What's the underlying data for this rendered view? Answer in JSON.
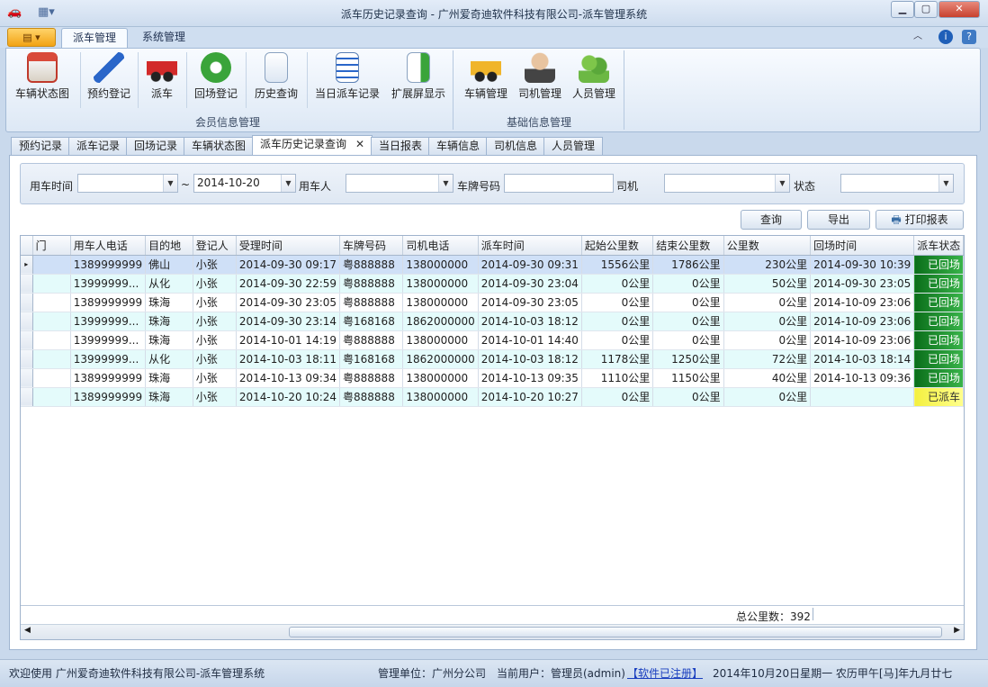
{
  "window": {
    "title": "派车历史记录查询 - 广州爱奇迪软件科技有限公司-派车管理系统"
  },
  "ribbon_tabs": [
    "派车管理",
    "系统管理"
  ],
  "ribbon_buttons": [
    {
      "label": "车辆状态图",
      "icon": "house-icon"
    },
    {
      "label": "预约登记",
      "icon": "pencil-icon"
    },
    {
      "label": "派车",
      "icon": "red-car-icon"
    },
    {
      "label": "回场登记",
      "icon": "green-refresh-icon"
    },
    {
      "label": "历史查询",
      "icon": "document-search-icon"
    },
    {
      "label": "当日派车记录",
      "icon": "checklist-icon"
    },
    {
      "label": "扩展屏显示",
      "icon": "export-document-icon"
    },
    {
      "label": "车辆管理",
      "icon": "taxi-icon"
    },
    {
      "label": "司机管理",
      "icon": "driver-icon"
    },
    {
      "label": "人员管理",
      "icon": "people-icon"
    }
  ],
  "ribbon_groups": [
    "会员信息管理",
    "基础信息管理"
  ],
  "doc_tabs": [
    "预约记录",
    "派车记录",
    "回场记录",
    "车辆状态图",
    "派车历史记录查询",
    "当日报表",
    "车辆信息",
    "司机信息",
    "人员管理"
  ],
  "filter": {
    "time_label": "用车时间",
    "time_from": "",
    "sep": "~",
    "time_to": "2014-10-20",
    "user_label": "用车人",
    "user_value": "",
    "plate_label": "车牌号码",
    "plate_value": "",
    "driver_label": "司机",
    "driver_value": "",
    "status_label": "状态",
    "status_value": ""
  },
  "actions": {
    "query": "查询",
    "export": "导出",
    "print": "打印报表"
  },
  "grid": {
    "columns": [
      "门",
      "用车人电话",
      "目的地",
      "登记人",
      "受理时间",
      "车牌号码",
      "司机电话",
      "派车时间",
      "起始公里数",
      "结束公里数",
      "公里数",
      "回场时间",
      "派车状态"
    ],
    "rows": [
      {
        "dept": "",
        "phone": "1389999999",
        "dest": "佛山",
        "reg": "小张",
        "accept": "2014-09-30 09:17",
        "plate": "粤888888",
        "dphone": "138000000",
        "dispatch": "2014-09-30 09:31",
        "start": "1556公里",
        "end": "1786公里",
        "km": "230公里",
        "return": "2014-09-30 10:39",
        "status": "已回场"
      },
      {
        "dept": "",
        "phone": "13999999...",
        "dest": "从化",
        "reg": "小张",
        "accept": "2014-09-30 22:59",
        "plate": "粤888888",
        "dphone": "138000000",
        "dispatch": "2014-09-30 23:04",
        "start": "0公里",
        "end": "0公里",
        "km": "50公里",
        "return": "2014-09-30 23:05",
        "status": "已回场"
      },
      {
        "dept": "",
        "phone": "1389999999",
        "dest": "珠海",
        "reg": "小张",
        "accept": "2014-09-30 23:05",
        "plate": "粤888888",
        "dphone": "138000000",
        "dispatch": "2014-09-30 23:05",
        "start": "0公里",
        "end": "0公里",
        "km": "0公里",
        "return": "2014-10-09 23:06",
        "status": "已回场"
      },
      {
        "dept": "",
        "phone": "13999999...",
        "dest": "珠海",
        "reg": "小张",
        "accept": "2014-09-30 23:14",
        "plate": "粤168168",
        "dphone": "1862000000",
        "dispatch": "2014-10-03 18:12",
        "start": "0公里",
        "end": "0公里",
        "km": "0公里",
        "return": "2014-10-09 23:06",
        "status": "已回场"
      },
      {
        "dept": "",
        "phone": "13999999...",
        "dest": "珠海",
        "reg": "小张",
        "accept": "2014-10-01 14:19",
        "plate": "粤888888",
        "dphone": "138000000",
        "dispatch": "2014-10-01 14:40",
        "start": "0公里",
        "end": "0公里",
        "km": "0公里",
        "return": "2014-10-09 23:06",
        "status": "已回场"
      },
      {
        "dept": "",
        "phone": "13999999...",
        "dest": "从化",
        "reg": "小张",
        "accept": "2014-10-03 18:11",
        "plate": "粤168168",
        "dphone": "1862000000",
        "dispatch": "2014-10-03 18:12",
        "start": "1178公里",
        "end": "1250公里",
        "km": "72公里",
        "return": "2014-10-03 18:14",
        "status": "已回场"
      },
      {
        "dept": "",
        "phone": "1389999999",
        "dest": "珠海",
        "reg": "小张",
        "accept": "2014-10-13 09:34",
        "plate": "粤888888",
        "dphone": "138000000",
        "dispatch": "2014-10-13 09:35",
        "start": "1110公里",
        "end": "1150公里",
        "km": "40公里",
        "return": "2014-10-13 09:36",
        "status": "已回场"
      },
      {
        "dept": "",
        "phone": "1389999999",
        "dest": "珠海",
        "reg": "小张",
        "accept": "2014-10-20 10:24",
        "plate": "粤888888",
        "dphone": "138000000",
        "dispatch": "2014-10-20 10:27",
        "start": "0公里",
        "end": "0公里",
        "km": "0公里",
        "return": "",
        "status": "已派车"
      }
    ],
    "total_label": "总公里数：392"
  },
  "statusbar": {
    "welcome": "欢迎使用 广州爱奇迪软件科技有限公司-派车管理系统",
    "unit": "管理单位：广州分公司",
    "user": "当前用户：管理员(admin)",
    "registered": "【软件已注册】",
    "date": "2014年10月20日星期一 农历甲午[马]年九月廿七"
  },
  "colors": {
    "status_returned": "#1a8a2a",
    "status_dispatched": "#f4f040",
    "accent": "#f2a314"
  }
}
